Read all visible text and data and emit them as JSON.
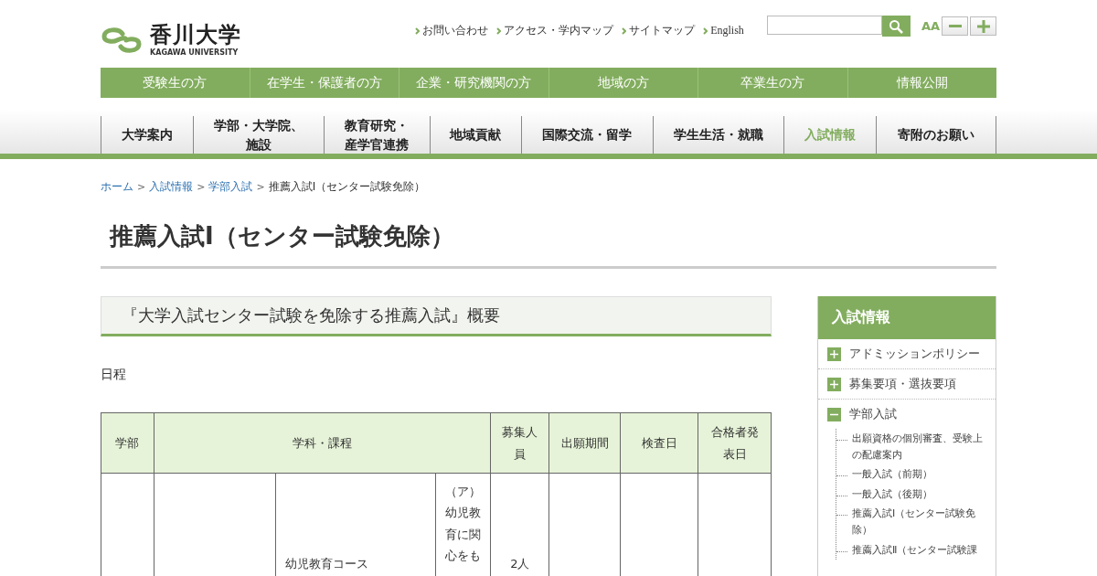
{
  "header": {
    "logo": {
      "name": "香川大学",
      "sub": "KAGAWA UNIVERSITY"
    },
    "utility_links": [
      "お問い合わせ",
      "アクセス・学内マップ",
      "サイトマップ",
      "English"
    ],
    "font_size": {
      "label": "AA"
    }
  },
  "audience_nav": [
    "受験生の方",
    "在学生・保護者の方",
    "企業・研究機関の方",
    "地域の方",
    "卒業生の方",
    "情報公開"
  ],
  "main_nav": [
    {
      "label": "大学案内",
      "selected": false
    },
    {
      "label": "学部・大学院、",
      "label_line_2": "施設",
      "selected": false
    },
    {
      "label": "教育研究・",
      "label_line_2": "産学官連携",
      "selected": false
    },
    {
      "label": "地域貢献",
      "selected": false
    },
    {
      "label": "国際交流・留学",
      "selected": false
    },
    {
      "label": "学生生活・就職",
      "selected": false
    },
    {
      "label": "入試情報",
      "selected": true
    },
    {
      "label": "寄附のお願い",
      "selected": false
    }
  ],
  "breadcrumb": [
    {
      "label": "ホーム",
      "kind": "link"
    },
    {
      "label": ">",
      "kind": "separator"
    },
    {
      "label": "入試情報",
      "kind": "link"
    },
    {
      "label": ">",
      "kind": "separator"
    },
    {
      "label": "学部入試",
      "kind": "link"
    },
    {
      "label": ">",
      "kind": "separator"
    },
    {
      "label": "推薦入試Ⅰ（センター試験免除）",
      "kind": "current"
    }
  ],
  "page_title": "推薦入試Ⅰ（センター試験免除）",
  "section_heading": "『大学入試センター試験を免除する推薦入試』概要",
  "schedule_label": "日程",
  "table": {
    "columns": [
      "学部",
      "学科・課程",
      "募集人員",
      "出願期間",
      "検査日",
      "合格者発表日"
    ],
    "rows": [
      {
        "course": "幼児教育コース",
        "qualification": "（ア）幼児教育に関心をも",
        "quota": "2人"
      }
    ]
  },
  "sidebar": {
    "title": "入試情報",
    "items": [
      {
        "label": "アドミッションポリシー",
        "expanded": false
      },
      {
        "label": "募集要項・選抜要項",
        "expanded": false
      },
      {
        "label": "学部入試",
        "expanded": true,
        "children": [
          "出願資格の個別審査、受験上の配慮案内",
          "一般入試（前期）",
          "一般入試（後期）",
          "推薦入試Ⅰ（センター試験免除）",
          "推薦入試Ⅱ（センター試験課"
        ]
      }
    ]
  }
}
